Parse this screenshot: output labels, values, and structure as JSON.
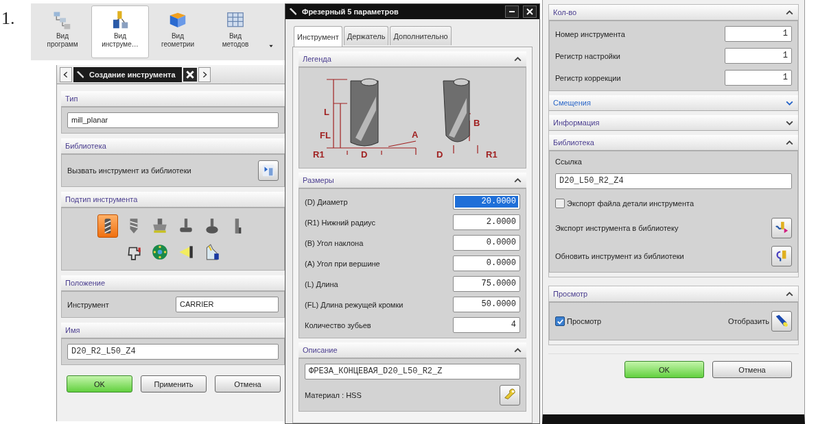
{
  "list_marker": "1.",
  "toolbar": {
    "buttons": [
      {
        "label": "Вид\nпрограмм",
        "kind": "program",
        "selected": false
      },
      {
        "label": "Вид\nинструме…",
        "kind": "tool",
        "selected": true
      },
      {
        "label": "Вид\nгеометрии",
        "kind": "geometry",
        "selected": false
      },
      {
        "label": "Вид\nметодов",
        "kind": "method",
        "selected": false
      }
    ]
  },
  "create_dialog": {
    "title": "Создание инструмента",
    "sections": [
      {
        "title": "Тип",
        "rows": [
          {
            "kind": "field",
            "value": "mill_planar"
          }
        ]
      },
      {
        "title": "Библиотека",
        "rows": [
          {
            "kind": "action",
            "label": "Вызвать инструмент из библиотеки"
          }
        ]
      },
      {
        "title": "Подтип инструмента",
        "rows": [
          {
            "kind": "icons",
            "items": [
              {
                "kind": "end-mill",
                "selected": true
              },
              {
                "kind": "drill",
                "selected": false
              },
              {
                "kind": "face-mill",
                "selected": false
              },
              {
                "kind": "t-cutter",
                "selected": false
              },
              {
                "kind": "ball",
                "selected": false
              },
              {
                "kind": "slim",
                "selected": false
              },
              {
                "kind": "cross",
                "selected": false
              },
              {
                "kind": "wheel",
                "selected": false
              },
              {
                "kind": "cone",
                "selected": false
              },
              {
                "kind": "step",
                "selected": false
              }
            ]
          }
        ]
      },
      {
        "title": "Положение",
        "rows": [
          {
            "kind": "field",
            "label": "Инструмент",
            "value": "CARRIER"
          }
        ]
      },
      {
        "title": "Имя",
        "rows": [
          {
            "kind": "code-field",
            "value": "D20_R2_L50_Z4"
          }
        ]
      }
    ],
    "buttons": [
      {
        "label": "OK",
        "kind": "primary"
      },
      {
        "label": "Применить",
        "kind": "normal"
      },
      {
        "label": "Отмена",
        "kind": "normal"
      }
    ]
  },
  "mill_dialog": {
    "title": "Фрезерный 5 параметров",
    "tabs": [
      {
        "label": "Инструмент",
        "selected": true
      },
      {
        "label": "Держатель",
        "selected": false
      },
      {
        "label": "Дополнительно",
        "selected": false
      }
    ],
    "sections": [
      {
        "title": "Легенда",
        "expanded": true,
        "rows": [
          {
            "kind": "legend",
            "labels": [
              "L",
              "FL",
              "A",
              "R1",
              "D",
              "B",
              "D",
              "R1"
            ]
          }
        ]
      },
      {
        "title": "Размеры",
        "expanded": true,
        "rows": [
          {
            "kind": "number",
            "label": "(D) Диаметр",
            "value": "20.0000",
            "selected": true
          },
          {
            "kind": "number",
            "label": "(R1) Нижний радиус",
            "value": "2.0000",
            "selected": false
          },
          {
            "kind": "number",
            "label": "(B) Угол наклона",
            "value": "0.0000",
            "selected": false
          },
          {
            "kind": "number",
            "label": "(A) Угол при вершине",
            "value": "0.0000",
            "selected": false
          },
          {
            "kind": "number",
            "label": "(L) Длина",
            "value": "75.0000",
            "selected": false
          },
          {
            "kind": "number",
            "label": "(FL) Длина режущей кромки",
            "value": "50.0000",
            "selected": false
          },
          {
            "kind": "number",
            "label": "Количество зубьев",
            "value": "4",
            "selected": false
          }
        ]
      },
      {
        "title": "Описание",
        "expanded": true,
        "rows": [
          {
            "kind": "code-field",
            "value": "ФРЕЗА_КОНЦЕВАЯ_D20_L50_R2_Z"
          },
          {
            "kind": "action",
            "label": "Материал : HSS"
          }
        ]
      }
    ]
  },
  "settings_dialog": {
    "groups": [
      {
        "sections": [
          {
            "title": "Кол-во",
            "expanded": true,
            "hovered": false,
            "rows": [
              {
                "kind": "number",
                "label": "Номер инструмента",
                "value": "1",
                "selected": false
              },
              {
                "kind": "number",
                "label": "Регистр настройки",
                "value": "1",
                "selected": false
              },
              {
                "kind": "number",
                "label": "Регистр коррекции",
                "value": "1",
                "selected": false
              }
            ]
          },
          {
            "title": "Смещения",
            "expanded": false,
            "hovered": true
          },
          {
            "title": "Информация",
            "expanded": false,
            "hovered": false
          },
          {
            "title": "Библиотека",
            "expanded": true,
            "hovered": false,
            "rows": [
              {
                "kind": "caption",
                "label": "Ссылка"
              },
              {
                "kind": "code-field",
                "value": "D20_L50_R2_Z4"
              },
              {
                "kind": "check",
                "label": "Экспорт файла детали инструмента",
                "checked": false
              },
              {
                "kind": "action",
                "label": "Экспорт инструмента в библиотеку"
              },
              {
                "kind": "action",
                "label": "Обновить инструмент из библиотеки"
              }
            ]
          }
        ]
      },
      {
        "sections": [
          {
            "title": "Просмотр",
            "expanded": true,
            "hovered": false,
            "rows": [
              {
                "kind": "check-action",
                "label": "Просмотр",
                "checked": true,
                "action_label": "Отобразить"
              }
            ]
          }
        ]
      }
    ],
    "buttons": [
      {
        "label": "OK",
        "kind": "primary"
      },
      {
        "label": "Отмена",
        "kind": "normal"
      }
    ]
  }
}
